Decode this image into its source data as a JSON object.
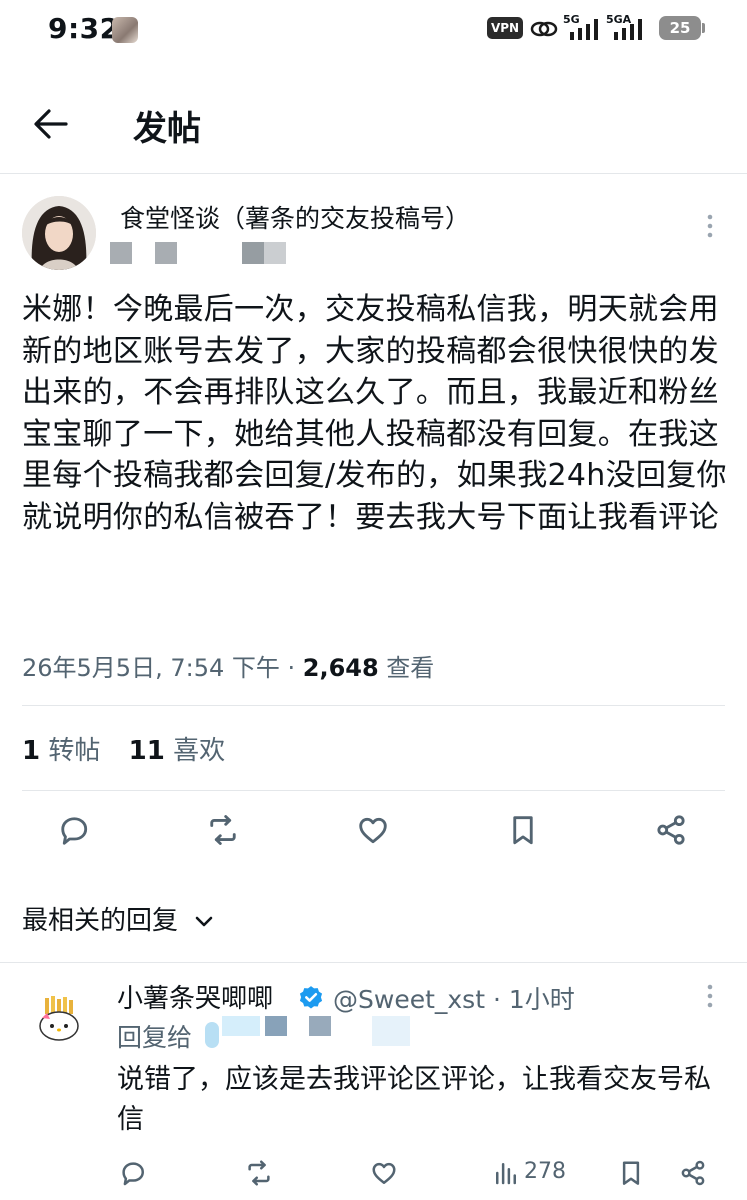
{
  "status_bar": {
    "time": "9:32",
    "vpn": "VPN",
    "signal1_label": "5G",
    "signal2_label": "5GA",
    "battery": "25"
  },
  "header": {
    "title": "发帖"
  },
  "post": {
    "author_name": "食堂怪谈（薯条的交友投稿号）",
    "body": "米娜！今晚最后一次，交友投稿私信我，明天就会用新的地区账号去发了，大家的投稿都会很快很快的发出来的，不会再排队这么久了。而且，我最近和粉丝宝宝聊了一下，她给其他人投稿都没有回复。在我这里每个投稿我都会回复/发布的，如果我24h没回复你就说明你的私信被吞了！要去我大号下面让我看评论",
    "timestamp": "26年5月5日, 7:54 下午",
    "views_separator": " · ",
    "views_count": "2,648",
    "views_label": " 查看",
    "reposts_count": "1",
    "reposts_label": " 转帖",
    "likes_count": "11",
    "likes_label": " 喜欢"
  },
  "replies_sort": {
    "label": "最相关的回复"
  },
  "reply": {
    "author_name": "小薯条哭唧唧",
    "handle": "@Sweet_xst",
    "time": " · 1小时",
    "reply_to_label": "回复给",
    "body": "说错了，应该是去我评论区评论，让我看交友号私信",
    "views": "278"
  },
  "colors": {
    "text_primary": "#0f1419",
    "text_secondary": "#536471",
    "verified_badge": "#1d9bf0",
    "divider": "#e4e7ea"
  }
}
